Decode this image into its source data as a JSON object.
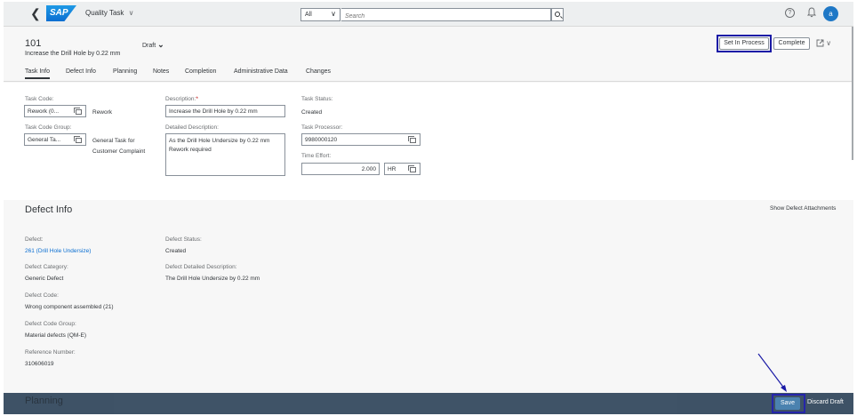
{
  "shell": {
    "back_icon": "back-arrow",
    "logo_text": "SAP",
    "app_title": "Quality Task",
    "app_title_chevron": "∨",
    "search_scope": "All",
    "search_scope_chevron": "∨",
    "search_placeholder": "Search",
    "help_glyph": "?",
    "avatar_initial": "a"
  },
  "header": {
    "object_number": "101",
    "object_subtitle": "Increase the Drill Hole by 0.22 mm",
    "draft_label": "Draft",
    "draft_chevron": "⌄",
    "set_in_process_label": "Set In Process",
    "complete_label": "Complete",
    "share_chevron": "∨"
  },
  "tabs": [
    "Task Info",
    "Defect Info",
    "Planning",
    "Notes",
    "Completion",
    "Administrative Data",
    "Changes"
  ],
  "task_info": {
    "task_code_label": "Task Code:",
    "task_code_value": "Rework (0...",
    "task_code_text": "Rework",
    "task_code_group_label": "Task Code Group:",
    "task_code_group_value": "General Ta...",
    "task_code_group_text_1": "General Task for",
    "task_code_group_text_2": "Customer Complaint",
    "description_label": "Description:",
    "required_marker": "*",
    "description_value": "Increase the Drill Hole by 0.22 mm",
    "detailed_description_label": "Detailed Description:",
    "detailed_description_value": "As the Drill Hole Undersize by 0.22 mm Rework required",
    "task_status_label": "Task Status:",
    "task_status_value": "Created",
    "task_processor_label": "Task Processor:",
    "task_processor_value": "9980000120",
    "time_effort_label": "Time Effort:",
    "time_effort_value": "2.000",
    "time_effort_unit": "HR"
  },
  "defect_info": {
    "title": "Defect Info",
    "show_attachments_label": "Show Defect Attachments",
    "defect_label": "Defect:",
    "defect_value": "261 (Drill Hole Undersize)",
    "defect_category_label": "Defect Category:",
    "defect_category_value": "Generic Defect",
    "defect_code_label": "Defect Code:",
    "defect_code_value": "Wrong component assembled (21)",
    "defect_code_group_label": "Defect Code Group:",
    "defect_code_group_value": "Material defects (QM-E)",
    "reference_number_label": "Reference Number:",
    "reference_number_value": "310606019",
    "defect_status_label": "Defect Status:",
    "defect_status_value": "Created",
    "defect_detailed_description_label": "Defect Detailed Description:",
    "defect_detailed_description_value": "The Drill Hole Undersize by 0.22 mm"
  },
  "footer": {
    "planning_title": "Planning",
    "save_label": "Save",
    "discard_label": "Discard Draft"
  },
  "colors": {
    "highlight": "#1a1aa6",
    "footer_bg": "#354a5f",
    "save_bg": "#427cac",
    "link": "#0a6ed1",
    "avatar": "#1f78c6"
  }
}
